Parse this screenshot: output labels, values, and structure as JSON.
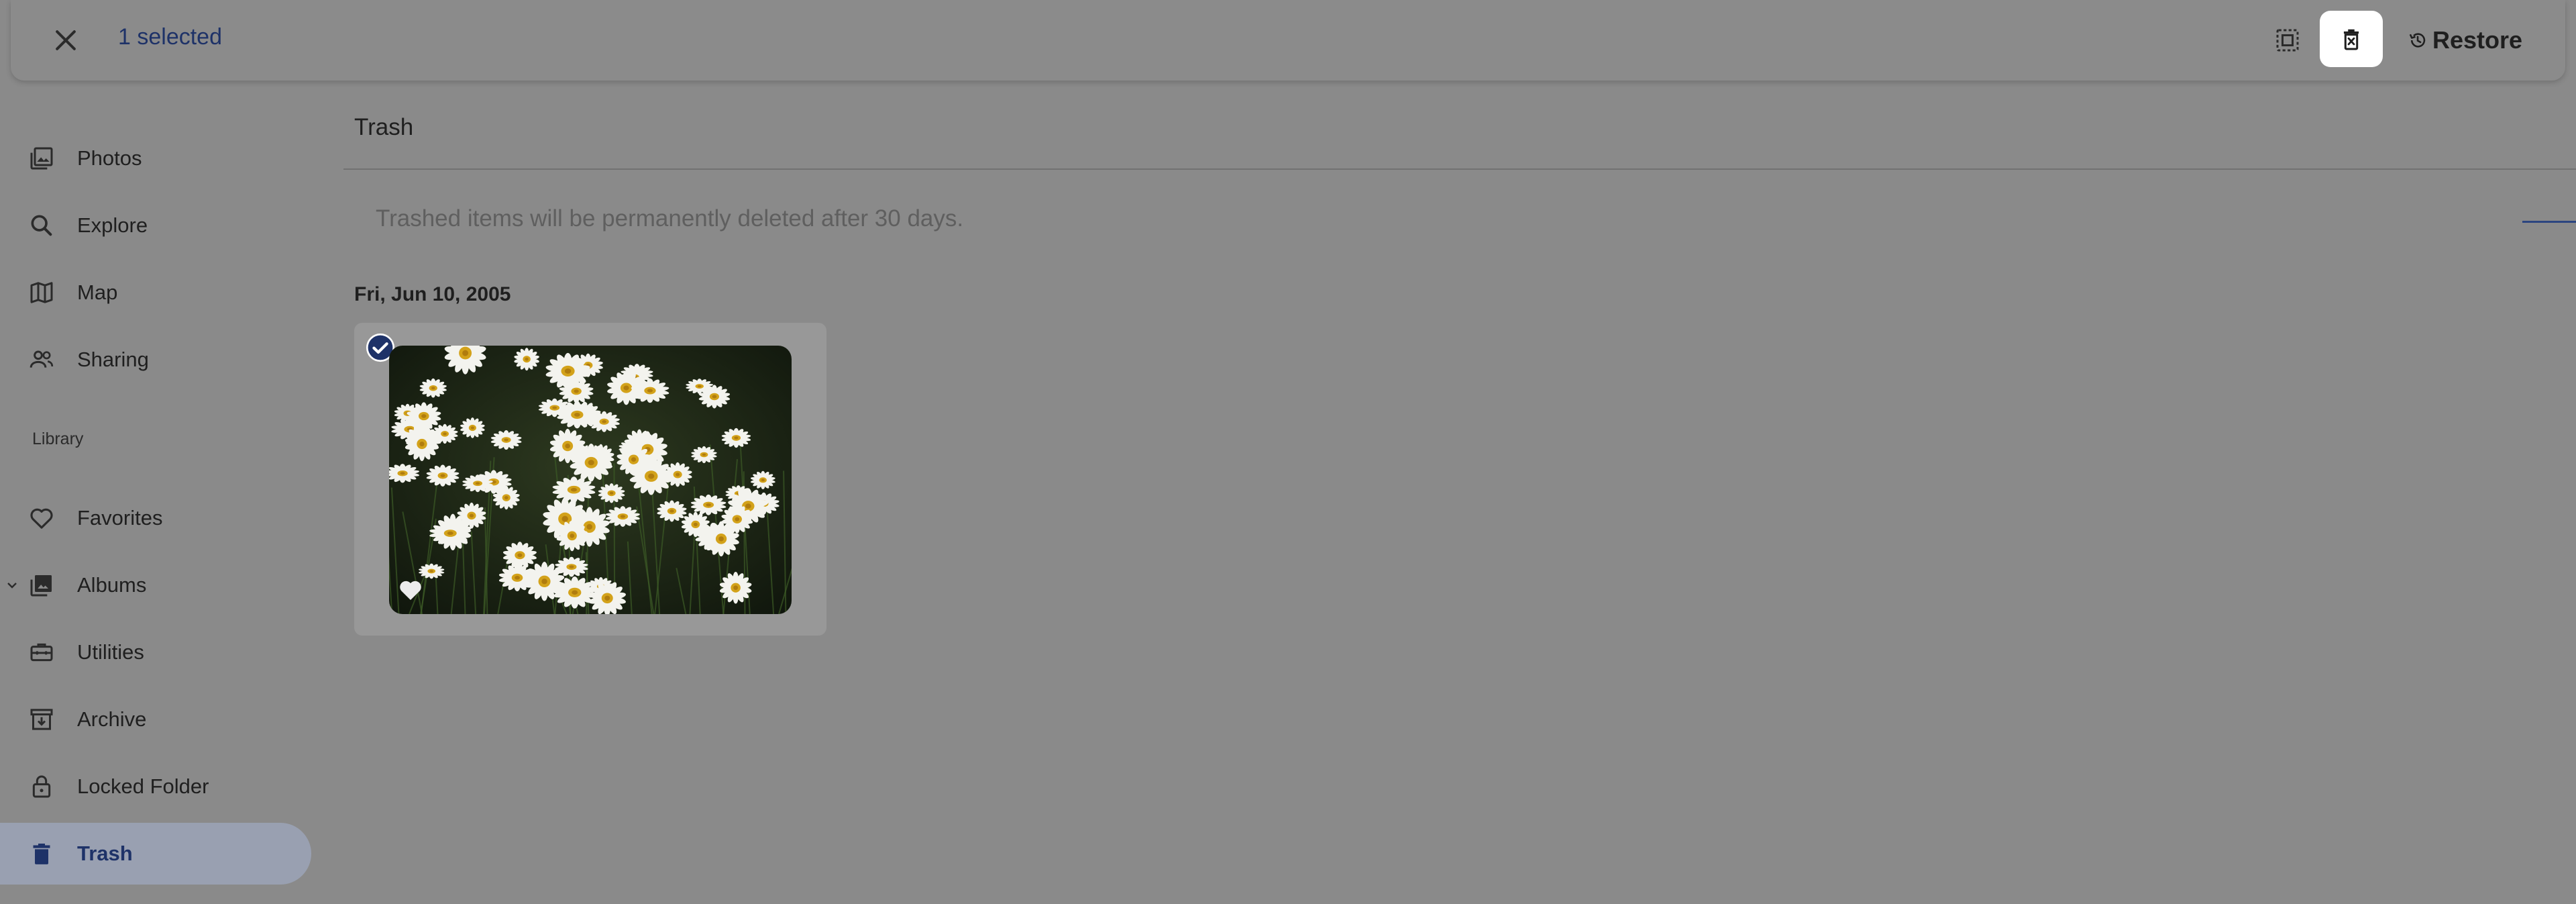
{
  "topbar": {
    "selected_text": "1 selected",
    "restore_label": "Restore"
  },
  "sidebar": {
    "items": [
      {
        "label": "Photos",
        "icon": "photos-icon"
      },
      {
        "label": "Explore",
        "icon": "search-icon"
      },
      {
        "label": "Map",
        "icon": "map-icon"
      },
      {
        "label": "Sharing",
        "icon": "people-icon"
      }
    ],
    "library_label": "Library",
    "library_items": [
      {
        "label": "Favorites",
        "icon": "heart-icon"
      },
      {
        "label": "Albums",
        "icon": "albums-icon"
      },
      {
        "label": "Utilities",
        "icon": "toolbox-icon"
      },
      {
        "label": "Archive",
        "icon": "archive-icon"
      },
      {
        "label": "Locked Folder",
        "icon": "lock-icon"
      },
      {
        "label": "Trash",
        "icon": "trash-icon",
        "active": true
      }
    ]
  },
  "main": {
    "title": "Trash",
    "notice": "Trashed items will be permanently deleted after 30 days.",
    "groups": [
      {
        "date": "Fri, Jun 10, 2005",
        "photos": [
          {
            "selected": true,
            "favorite": true
          }
        ]
      }
    ]
  },
  "colors": {
    "accent": "#1e3268",
    "overlay_bg": "#8a8a8a",
    "active_nav_bg": "#99a0b1"
  }
}
